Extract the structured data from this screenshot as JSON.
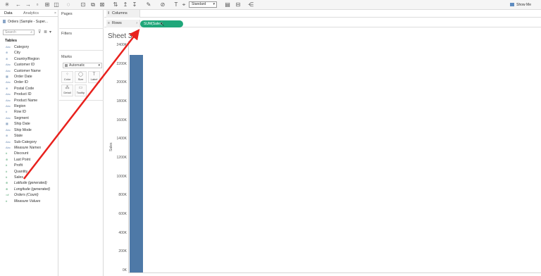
{
  "toolbar": {
    "fit_select": "Standard",
    "show_me_label": "Show Me"
  },
  "data_pane": {
    "tabs": [
      "Data",
      "Analytics"
    ],
    "close_glyph": "×",
    "datasource": "Orders (Sample - Super...",
    "search_placeholder": "Search",
    "tables_title": "Tables",
    "fields": [
      {
        "name": "Category",
        "kind": "Abc",
        "measure": false,
        "italic": false
      },
      {
        "name": "City",
        "kind": "⊕",
        "measure": false,
        "italic": false
      },
      {
        "name": "Country/Region",
        "kind": "⊕",
        "measure": false,
        "italic": false
      },
      {
        "name": "Customer ID",
        "kind": "Abc",
        "measure": false,
        "italic": false
      },
      {
        "name": "Customer Name",
        "kind": "Abc",
        "measure": false,
        "italic": false
      },
      {
        "name": "Order Date",
        "kind": "▦",
        "measure": false,
        "italic": false
      },
      {
        "name": "Order ID",
        "kind": "Abc",
        "measure": false,
        "italic": false
      },
      {
        "name": "Postal Code",
        "kind": "⊕",
        "measure": false,
        "italic": false
      },
      {
        "name": "Product ID",
        "kind": "Abc",
        "measure": false,
        "italic": false
      },
      {
        "name": "Product Name",
        "kind": "Abc",
        "measure": false,
        "italic": false
      },
      {
        "name": "Region",
        "kind": "Abc",
        "measure": false,
        "italic": false
      },
      {
        "name": "Row ID",
        "kind": "#",
        "measure": false,
        "italic": false
      },
      {
        "name": "Segment",
        "kind": "Abc",
        "measure": false,
        "italic": false
      },
      {
        "name": "Ship Date",
        "kind": "▦",
        "measure": false,
        "italic": false
      },
      {
        "name": "Ship Mode",
        "kind": "Abc",
        "measure": false,
        "italic": false
      },
      {
        "name": "State",
        "kind": "⊕",
        "measure": false,
        "italic": false
      },
      {
        "name": "Sub-Category",
        "kind": "Abc",
        "measure": false,
        "italic": false
      },
      {
        "name": "Measure Names",
        "kind": "Abc",
        "measure": false,
        "italic": true
      },
      {
        "name": "Discount",
        "kind": "#",
        "measure": true,
        "italic": false
      },
      {
        "name": "Last Point",
        "kind": "⊕",
        "measure": true,
        "italic": false
      },
      {
        "name": "Profit",
        "kind": "#",
        "measure": true,
        "italic": false
      },
      {
        "name": "Quantity",
        "kind": "#",
        "measure": true,
        "italic": false
      },
      {
        "name": "Sales",
        "kind": "#",
        "measure": true,
        "italic": false
      },
      {
        "name": "Latitude (generated)",
        "kind": "⊕",
        "measure": true,
        "italic": true
      },
      {
        "name": "Longitude (generated)",
        "kind": "⊕",
        "measure": true,
        "italic": true
      },
      {
        "name": "Orders (Count)",
        "kind": "=#",
        "measure": true,
        "italic": true
      },
      {
        "name": "Measure Values",
        "kind": "#",
        "measure": true,
        "italic": true
      }
    ]
  },
  "cards": {
    "pages_title": "Pages",
    "filters_title": "Filters",
    "marks_title": "Marks",
    "mark_type": "Automatic",
    "mark_buttons": [
      {
        "label": "Color",
        "icon": "⁘"
      },
      {
        "label": "Size",
        "icon": "◯"
      },
      {
        "label": "Label",
        "icon": "T"
      },
      {
        "label": "Detail",
        "icon": "⁂"
      },
      {
        "label": "Tooltip",
        "icon": "▭"
      }
    ]
  },
  "shelves": {
    "columns_label": "Columns",
    "rows_label": "Rows",
    "rows_pill": "SUM(Sales)"
  },
  "view": {
    "sheet_title": "Sheet 3"
  },
  "chart_data": {
    "type": "bar",
    "title": "Sheet 3",
    "ylabel": "Sales",
    "xlabel": "",
    "ylim": [
      0,
      2400000
    ],
    "yticks": [
      0,
      200000,
      400000,
      600000,
      800000,
      1000000,
      1200000,
      1400000,
      1600000,
      1800000,
      2000000,
      2200000,
      2400000
    ],
    "ytick_labels": [
      "0K",
      "200K",
      "400K",
      "600K",
      "800K",
      "1000K",
      "1200K",
      "1400K",
      "1600K",
      "1800K",
      "2000K",
      "2200K",
      "2400K"
    ],
    "categories": [
      ""
    ],
    "values": [
      2297201
    ],
    "color": "#4e79a7",
    "grid": false
  },
  "colors": {
    "pill": "#1fa77a",
    "bar": "#4e79a7",
    "arrow": "#e8211d"
  }
}
